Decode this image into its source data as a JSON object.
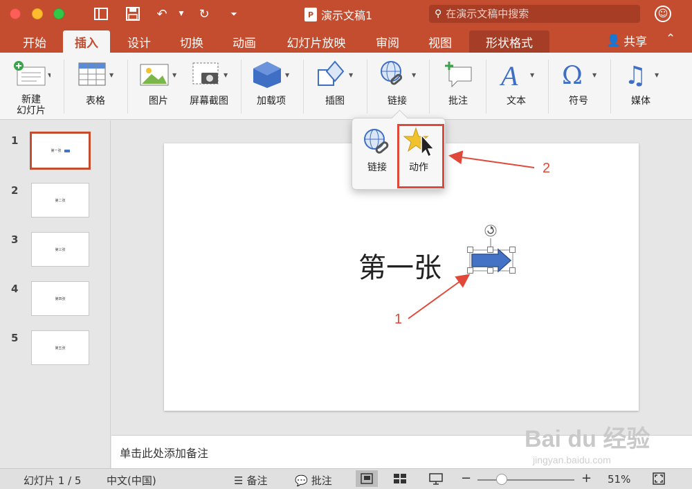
{
  "window": {
    "title": "演示文稿1",
    "search_placeholder": "在演示文稿中搜索"
  },
  "tabs": [
    {
      "label": "开始"
    },
    {
      "label": "插入"
    },
    {
      "label": "设计"
    },
    {
      "label": "切换"
    },
    {
      "label": "动画"
    },
    {
      "label": "幻灯片放映"
    },
    {
      "label": "审阅"
    },
    {
      "label": "视图"
    },
    {
      "label": "形状格式"
    }
  ],
  "share_label": "共享",
  "ribbon": {
    "new_slide": "新建\n幻灯片",
    "new_slide_line1": "新建",
    "new_slide_line2": "幻灯片",
    "table": "表格",
    "picture": "图片",
    "screenshot": "屏幕截图",
    "addins": "加载项",
    "illustration": "插图",
    "link": "链接",
    "comment": "批注",
    "text": "文本",
    "symbol": "符号",
    "media": "媒体"
  },
  "popover": {
    "link": "链接",
    "action": "动作"
  },
  "slides": [
    {
      "num": "1",
      "caption": "第一张"
    },
    {
      "num": "2",
      "caption": "第二张"
    },
    {
      "num": "3",
      "caption": "第三张"
    },
    {
      "num": "4",
      "caption": "第四张"
    },
    {
      "num": "5",
      "caption": "第五张"
    }
  ],
  "slide_title": "第一张",
  "notes_placeholder": "单击此处添加备注",
  "status": {
    "slide_indicator": "幻灯片 1 / 5",
    "language": "中文(中国)",
    "notes": "备注",
    "comments": "批注",
    "zoom": "51%",
    "zoom_minus": "−",
    "zoom_plus": "+"
  },
  "annotations": {
    "one": "1",
    "two": "2"
  },
  "watermark": {
    "brand": "Bai du 经验",
    "url": "jingyan.baidu.com"
  },
  "colors": {
    "accent": "#c44c2f",
    "annotation": "#e0493a",
    "arrow_fill": "#4472c4"
  }
}
